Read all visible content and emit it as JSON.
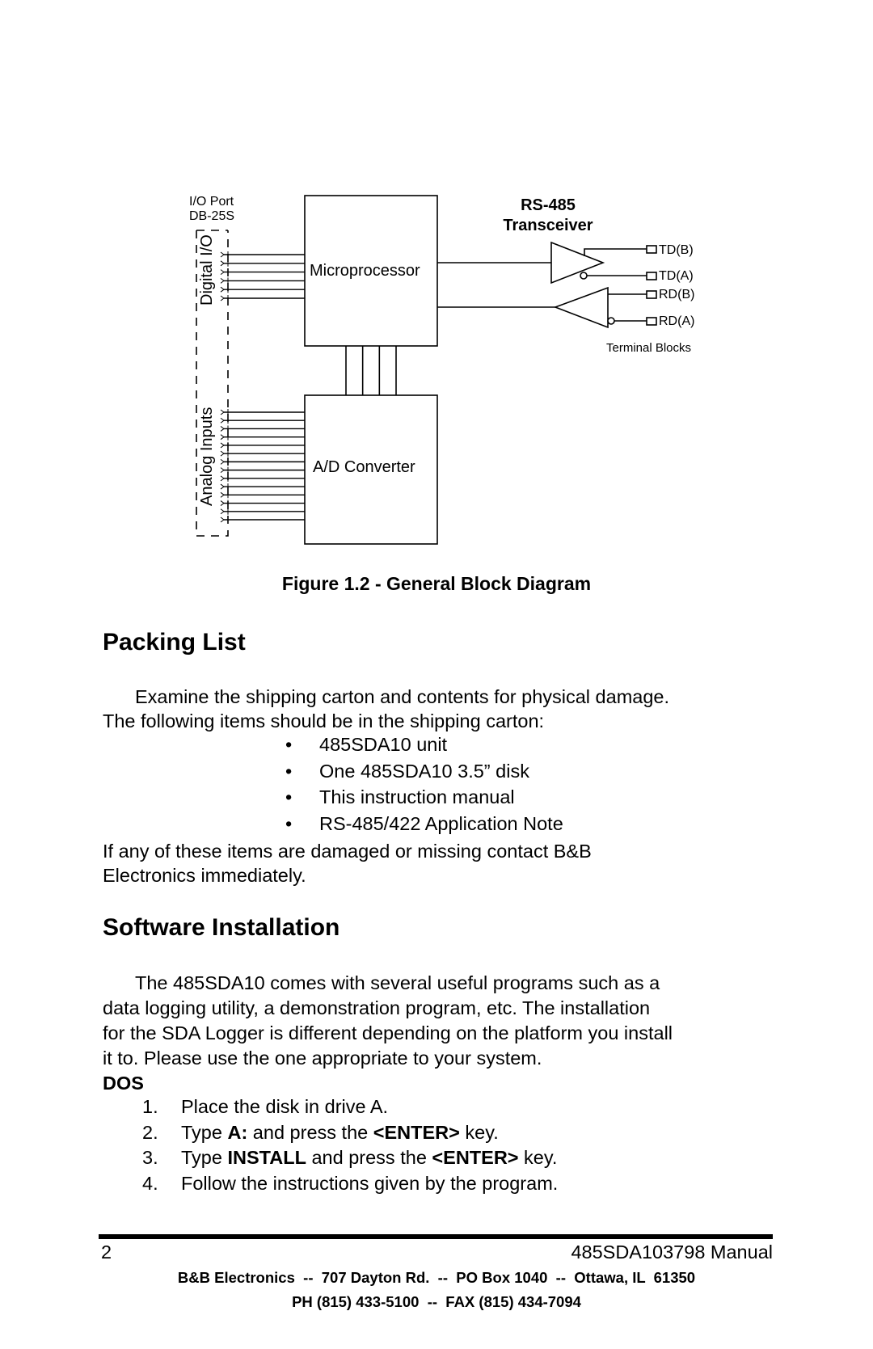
{
  "figure": {
    "labels": {
      "io_port": "I/O Port",
      "db25s": "DB-25S",
      "digital_io": "Digital I/O",
      "analog_inputs": "Analog Inputs",
      "microprocessor": "Microprocessor",
      "ad_converter": "A/D Converter",
      "rs485": "RS-485",
      "transceiver": "Transceiver",
      "td_b": "TD(B)",
      "td_a": "TD(A)",
      "rd_b": "RD(B)",
      "rd_a": "RD(A)",
      "terminal_blocks": "Terminal Blocks"
    },
    "digital_line_count": 6,
    "analog_line_count": 14,
    "bus_line_count": 4,
    "caption": "Figure 1.2 - General Block Diagram"
  },
  "packing_list": {
    "heading": "Packing List",
    "intro_line1": "Examine the shipping carton and contents for physical damage.",
    "intro_line2": "The following items should be in the shipping carton:",
    "items": [
      "485SDA10 unit",
      "One 485SDA10 3.5” disk",
      "This instruction manual",
      "RS-485/422 Application Note"
    ],
    "bullet_char": "•",
    "outro_line1": "If any of these items are damaged or missing contact B&B",
    "outro_line2": "Electronics immediately."
  },
  "software_installation": {
    "heading": "Software Installation",
    "para_lines": [
      "The 485SDA10 comes with several useful programs such as a",
      "data logging utility, a demonstration program, etc.  The installation",
      "for the SDA Logger is different depending on the platform you install",
      "it to.  Please use the one appropriate to your system."
    ],
    "dos_heading": "DOS",
    "steps": [
      {
        "num": "1.",
        "parts": [
          {
            "t": "Place the disk in drive A.",
            "b": false
          }
        ]
      },
      {
        "num": "2.",
        "parts": [
          {
            "t": "Type ",
            "b": false
          },
          {
            "t": "A:",
            "b": true
          },
          {
            "t": " and press the ",
            "b": false
          },
          {
            "t": "<ENTER>",
            "b": true
          },
          {
            "t": " key.",
            "b": false
          }
        ]
      },
      {
        "num": "3.",
        "parts": [
          {
            "t": "Type ",
            "b": false
          },
          {
            "t": "INSTALL",
            "b": true
          },
          {
            "t": " and press the ",
            "b": false
          },
          {
            "t": "<ENTER>",
            "b": true
          },
          {
            "t": " key.",
            "b": false
          }
        ]
      },
      {
        "num": "4.",
        "parts": [
          {
            "t": "Follow the instructions given by the program.",
            "b": false
          }
        ]
      }
    ]
  },
  "footer": {
    "page_number": "2",
    "manual_title": "485SDA103798 Manual",
    "address": "B&B Electronics  --  707 Dayton Rd.  --  PO Box 1040  --  Ottawa, IL  61350",
    "phone": "PH (815) 433-5100  --  FAX (815) 434-7094"
  }
}
